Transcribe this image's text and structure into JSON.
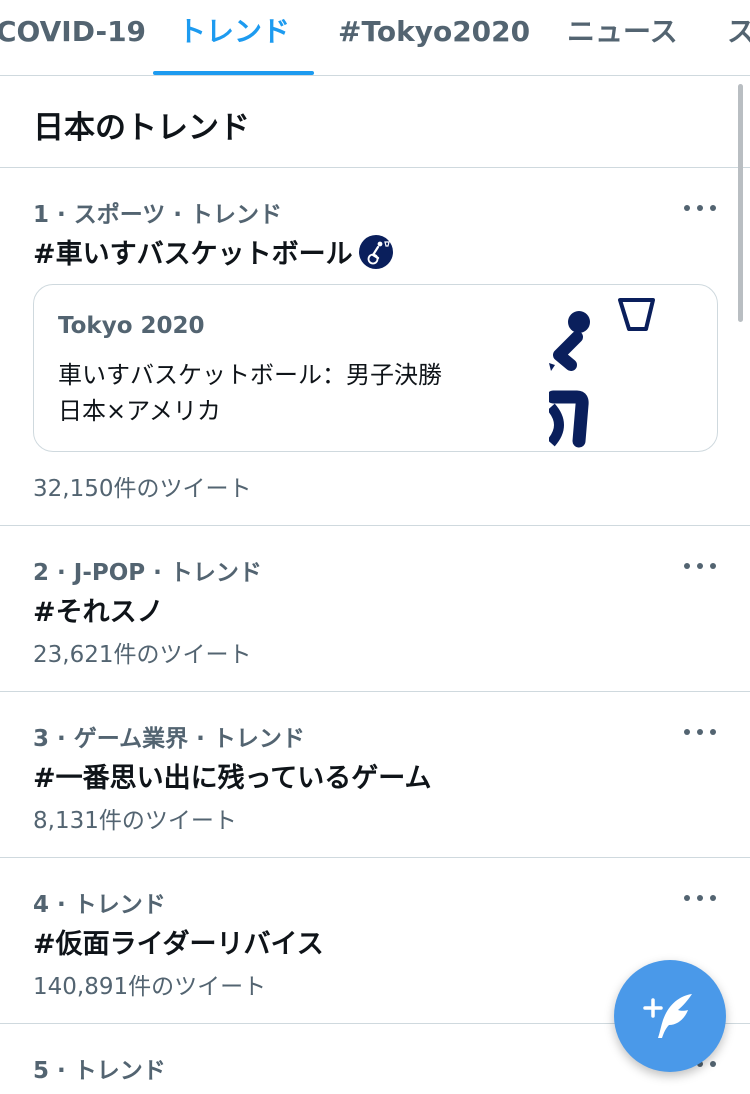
{
  "tabs": [
    {
      "label": "COVID-19",
      "active": false
    },
    {
      "label": "トレンド",
      "active": true
    },
    {
      "label": "#Tokyo2020",
      "active": false
    },
    {
      "label": "ニュース",
      "active": false
    },
    {
      "label": "ス",
      "active": false
    }
  ],
  "section": {
    "title": "日本のトレンド"
  },
  "trends": [
    {
      "meta": "1 · スポーツ · トレンド",
      "name": "#車いすバスケットボール",
      "hashflag_icon": "wheelchair-basketball-icon",
      "card": {
        "source": "Tokyo 2020",
        "line1": "車いすバスケットボール：男子決勝",
        "line2": "日本×アメリカ",
        "image_icon": "wheelchair-basketball-pictogram"
      },
      "count": "32,150件のツイート"
    },
    {
      "meta": "2 · J-POP · トレンド",
      "name": "#それスノ",
      "count": "23,621件のツイート"
    },
    {
      "meta": "3 · ゲーム業界 · トレンド",
      "name": "#一番思い出に残っているゲーム",
      "count": "8,131件のツイート"
    },
    {
      "meta": "4 · トレンド",
      "name": "#仮面ライダーリバイス",
      "count": "140,891件のツイート"
    },
    {
      "meta": "5 · トレンド"
    }
  ],
  "fab": {
    "icon": "compose-tweet-icon"
  },
  "colors": {
    "accent": "#1d9bf0",
    "fab": "#4a99e9",
    "secondary_text": "#536471",
    "border": "#cfd9de",
    "pictogram": "#0a1f5c"
  }
}
